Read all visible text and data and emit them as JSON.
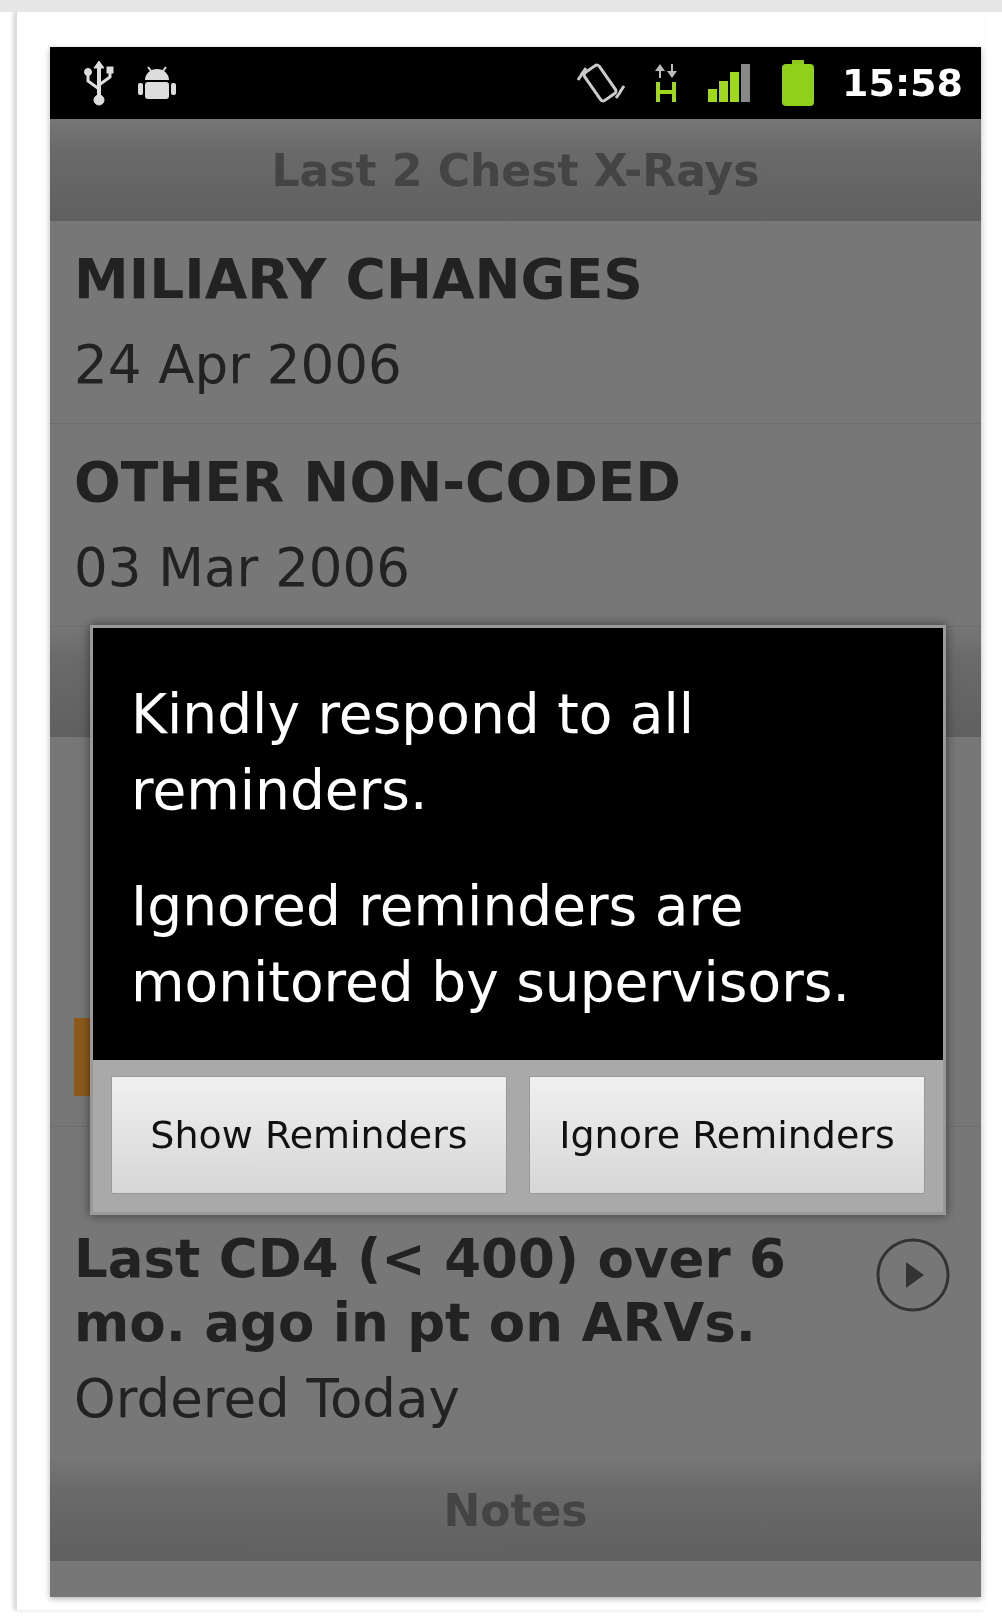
{
  "status_bar": {
    "time": "15:58"
  },
  "chest_xrays": {
    "header": "Last 2 Chest X-Rays",
    "items": [
      {
        "title": "MILIARY CHANGES",
        "date": "24 Apr 2006"
      },
      {
        "title": "OTHER NON-CODED",
        "date": "03 Mar 2006"
      }
    ]
  },
  "reminders": {
    "items": [
      {
        "kind": "tagged",
        "color": "#8c5a1c"
      },
      {
        "kind": "ordered",
        "title": "Last CD4 (< 400) over 6 mo. ago in pt on ARVs.",
        "status": "Ordered Today"
      }
    ]
  },
  "notes_header": "Notes",
  "dialog": {
    "messages": [
      "Kindly respond to all reminders.",
      "Ignored reminders are monitored by supervisors."
    ],
    "buttons": [
      "Show Reminders",
      "Ignore Reminders"
    ]
  }
}
